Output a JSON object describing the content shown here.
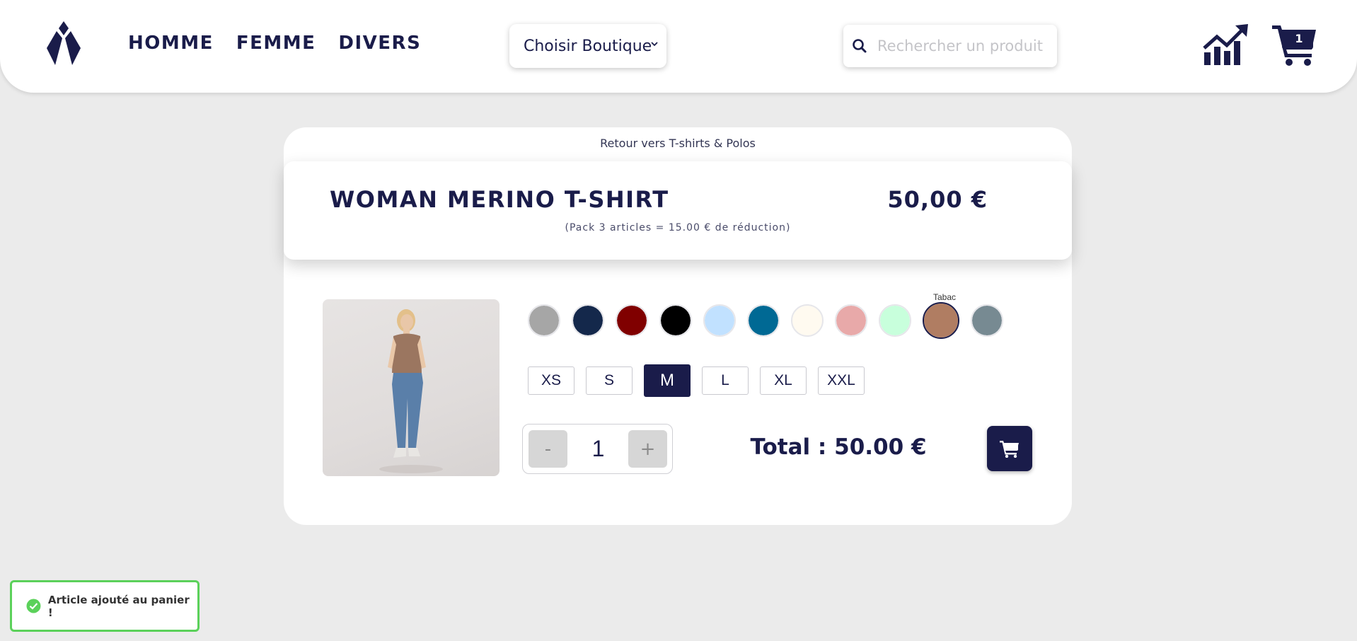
{
  "nav": {
    "items": [
      {
        "label": "HOMME"
      },
      {
        "label": "FEMME"
      },
      {
        "label": "DIVERS"
      }
    ]
  },
  "shop_select": {
    "value": "Choisir Boutique"
  },
  "search": {
    "placeholder": "Rechercher un produit",
    "icon": "search-icon"
  },
  "header_icons": {
    "stats": "chart-growth-icon",
    "cart": "cart-icon",
    "cart_count": "1"
  },
  "product": {
    "back_link": "Retour vers T-shirts & Polos",
    "name": "WOMAN MERINO T-SHIRT",
    "price": "50,00 €",
    "discount_note": "(Pack 3 articles = 15.00 € de réduction)",
    "colors": [
      {
        "hex": "#a6a6a6"
      },
      {
        "hex": "#14284b"
      },
      {
        "hex": "#800000"
      },
      {
        "hex": "#000000"
      },
      {
        "hex": "#c1e1ff"
      },
      {
        "hex": "#006994"
      },
      {
        "hex": "#fffaf0"
      },
      {
        "hex": "#e8a9a9"
      },
      {
        "hex": "#c8ffdc"
      },
      {
        "hex": "#b07d62",
        "label": "Tabac",
        "selected": true
      },
      {
        "hex": "#778a92"
      }
    ],
    "sizes": [
      {
        "label": "XS"
      },
      {
        "label": "S"
      },
      {
        "label": "M",
        "selected": true
      },
      {
        "label": "L"
      },
      {
        "label": "XL"
      },
      {
        "label": "XXL"
      }
    ],
    "quantity": {
      "minus": "-",
      "value": "1",
      "plus": "+"
    },
    "total": "Total : 50.00 €"
  },
  "toast": {
    "message": "Article ajouté au panier !",
    "icon": "check-circle-icon",
    "border_color": "#5bd15a"
  },
  "theme": {
    "primary": "#1a1c4a",
    "background": "#ebebeb"
  }
}
